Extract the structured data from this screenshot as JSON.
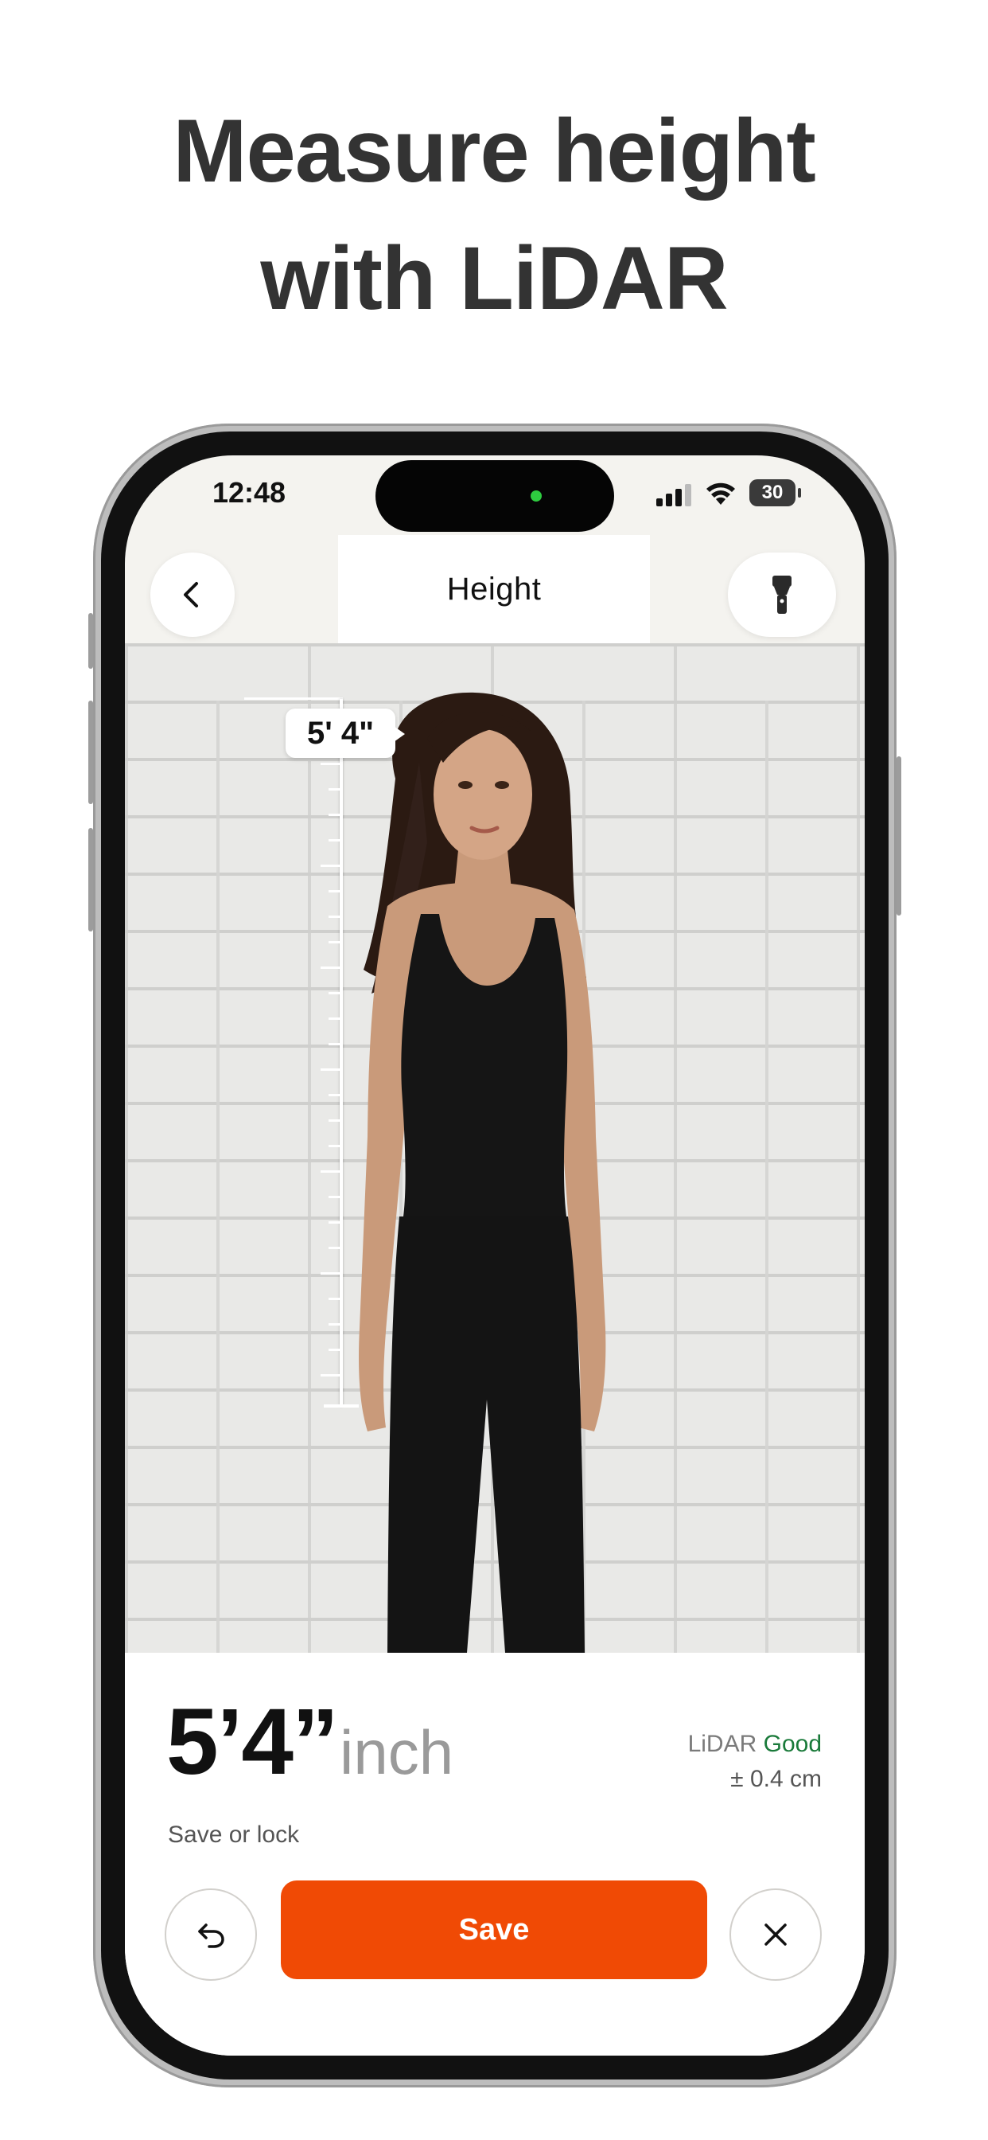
{
  "headline": {
    "line1": "Measure height",
    "line2": "with LiDAR"
  },
  "status_bar": {
    "time": "12:48",
    "battery": "30"
  },
  "nav": {
    "title": "Height",
    "back_icon": "chevron-left-icon",
    "torch_icon": "flashlight-icon"
  },
  "camera": {
    "height_label": "5' 4\""
  },
  "result": {
    "value": "5’4”",
    "unit": "inch",
    "sensor_label": "LiDAR",
    "sensor_quality": "Good",
    "accuracy": "± 0.4 cm",
    "hint": "Save or lock"
  },
  "actions": {
    "undo_icon": "undo-icon",
    "save_label": "Save",
    "close_icon": "close-icon"
  },
  "colors": {
    "accent": "#f04a05",
    "good": "#1a7a3a",
    "headline": "#333333"
  }
}
